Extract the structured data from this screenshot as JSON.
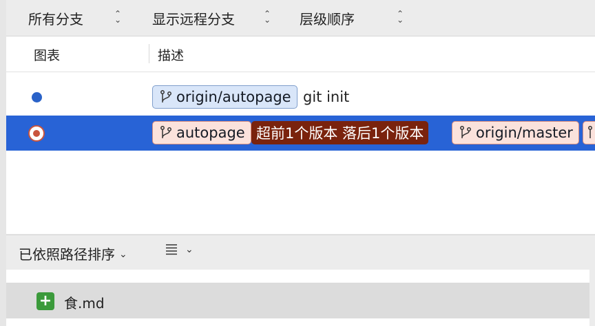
{
  "filters": [
    {
      "label": "所有分支"
    },
    {
      "label": "显示远程分支"
    },
    {
      "label": "层级顺序"
    }
  ],
  "table": {
    "col_graph": "图表",
    "col_desc": "描述"
  },
  "commits": [
    {
      "tags": [
        {
          "text": "origin/autopage",
          "style": "remote"
        }
      ],
      "message": "git init"
    },
    {
      "tags": [
        {
          "text": "autopage",
          "style": "local"
        },
        {
          "text": "超前1个版本 落后1个版本",
          "style": "status"
        },
        {
          "text": "origin/master",
          "style": "remote"
        }
      ],
      "message": ""
    }
  ],
  "sort": {
    "label": "已依照路径排序"
  },
  "files": [
    {
      "name": "食.md",
      "status_icon": "plus-icon"
    }
  ],
  "colors": {
    "selection": "#2863d6",
    "graph_dot": "#2a62c8",
    "status_tag": "#7a230d",
    "added": "#3b9a3b"
  }
}
